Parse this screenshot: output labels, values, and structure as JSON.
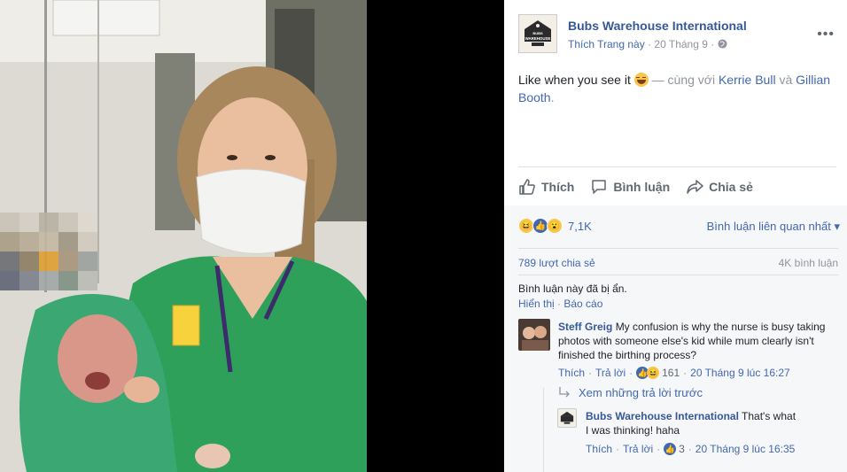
{
  "post": {
    "page_name": "Bubs Warehouse International",
    "like_page": "Thích Trang này",
    "dot": "·",
    "date": "20 Tháng 9",
    "more": "•••",
    "text": "Like when you see it",
    "with_text": " — cùng với ",
    "tag1": "Kerrie Bull",
    "and": " và ",
    "tag2": "Gillian Booth",
    "period": ".",
    "logo_text_top": "BUBS",
    "logo_text_main": "WAREHOUSE"
  },
  "actions": {
    "like": "Thích",
    "comment": "Bình luận",
    "share": "Chia sẻ"
  },
  "stats": {
    "reaction_count": "7,1K",
    "sort_label": "Bình luận liên quan nhất ▾",
    "shares": "789 lượt chia sẻ",
    "comments": "4K bình luận"
  },
  "hidden": {
    "note": "Bình luận này đã bị ẩn.",
    "show": "Hiển thị",
    "report": "Báo cáo",
    "dot": "·"
  },
  "comment1": {
    "name": "Steff Greig",
    "text": "My confusion is why the nurse is busy taking photos with someone else's kid while mum clearly isn't finished the birthing process?",
    "like": "Thích",
    "reply": "Trả lời",
    "count": "161",
    "time": "20 Tháng 9 lúc 16:27",
    "dot": "·"
  },
  "view_replies": "Xem những trả lời trước",
  "reply1": {
    "name": "Bubs Warehouse International",
    "text": "That's what I was thinking! haha",
    "like": "Thích",
    "reply": "Trả lời",
    "count": "3",
    "time": "20 Tháng 9 lúc 16:35",
    "dot": "·"
  },
  "colors": {
    "fb_blue": "#4267b2",
    "name_blue": "#365899",
    "meta_grey": "#90949c"
  }
}
